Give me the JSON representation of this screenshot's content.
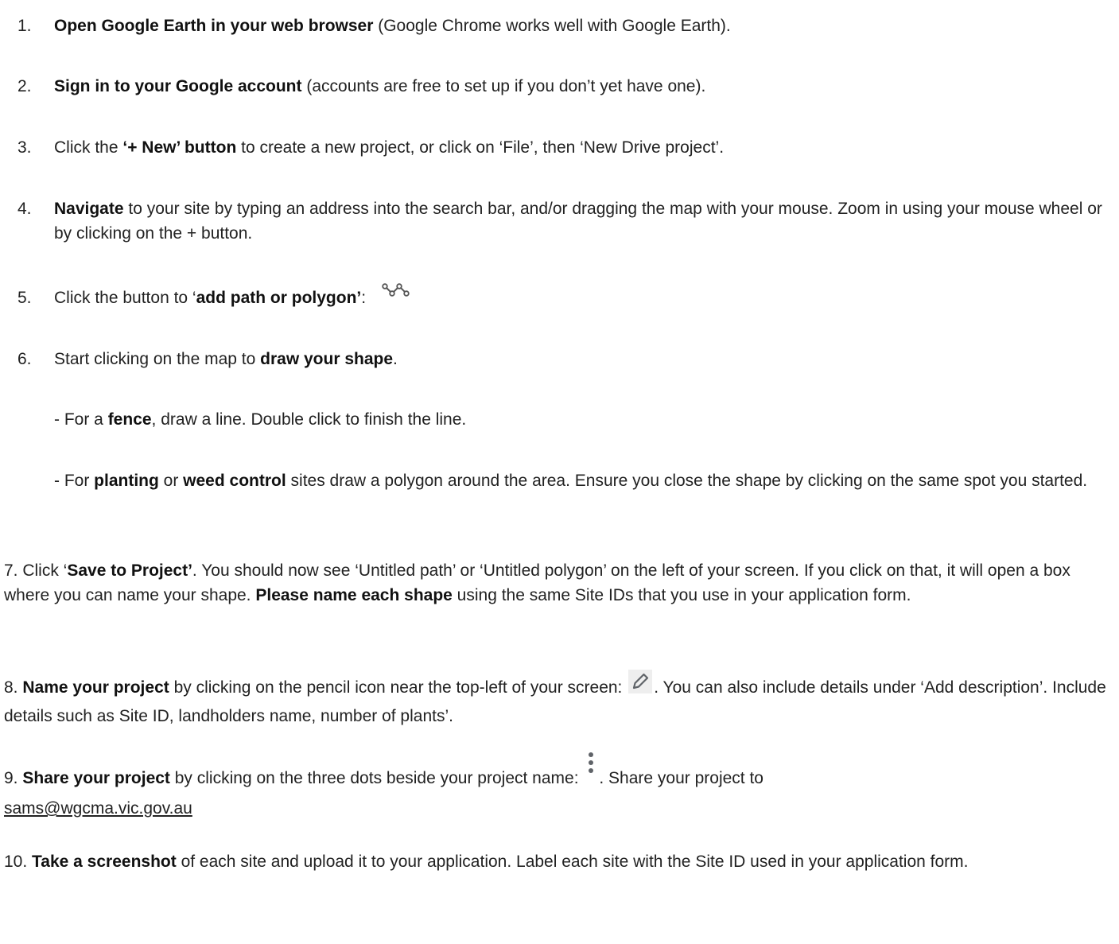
{
  "steps": {
    "s1": {
      "num": "1.",
      "bold": "Open Google Earth in your web browser",
      "rest": " (Google Chrome works well with Google Earth)."
    },
    "s2": {
      "num": "2.",
      "bold": "Sign in to your Google account",
      "rest": " (accounts are free to set up if you don’t yet have one)."
    },
    "s3": {
      "num": "3.",
      "pre": "Click the ",
      "bold": "‘+ New’ button",
      "rest": " to create a new project, or click on ‘File’, then ‘New Drive project’."
    },
    "s4": {
      "num": "4.",
      "bold": "Navigate",
      "rest": " to your site by typing an address into the search bar, and/or dragging the map with your mouse. Zoom in using your mouse wheel or by clicking on the + button."
    },
    "s5": {
      "num": "5.",
      "pre": "Click the button to ‘",
      "bold": "add path or polygon’",
      "rest": ":"
    },
    "s6": {
      "num": "6.",
      "pre": "Start clicking on the map to ",
      "bold": "draw your shape",
      "rest": ".",
      "fence": {
        "pre": "- For a ",
        "bold": "fence",
        "rest": ", draw a line. Double click to finish the line."
      },
      "planting": {
        "pre": "- For ",
        "bold1": "planting",
        "mid": " or ",
        "bold2": "weed control",
        "rest": " sites draw a polygon around the area. Ensure you close the shape by clicking on the same spot you started."
      }
    },
    "s7": {
      "pre": "7. Click ‘",
      "bold1": "Save to Project’",
      "mid": ". You should now see ‘Untitled path’ or ‘Untitled polygon’ on the left of your screen. If you click on that, it will open a box where you can name your shape. ",
      "bold2": "Please name each shape",
      "rest": " using the same Site IDs that you use in your application form."
    },
    "s8": {
      "pre": "8. ",
      "bold": "Name your project",
      "mid": " by clicking on the pencil icon near the top-left of your screen: ",
      "rest": ". You can also include details under ‘Add description’. Include details such as Site ID, landholders name, number of plants’."
    },
    "s9": {
      "pre": "9. ",
      "bold": "Share your project",
      "mid": " by clicking on the three dots beside your project name: ",
      "rest": ". Share your project to ",
      "email": "sams@wgcma.vic.gov.au"
    },
    "s10": {
      "pre": "10. ",
      "bold": "Take a screenshot",
      "rest": " of each site and upload it to your application. Label each site with the Site ID used in your application form."
    }
  },
  "icons": {
    "path": "path-polygon-icon",
    "pencil": "pencil-icon",
    "dots": "three-dots-icon"
  }
}
